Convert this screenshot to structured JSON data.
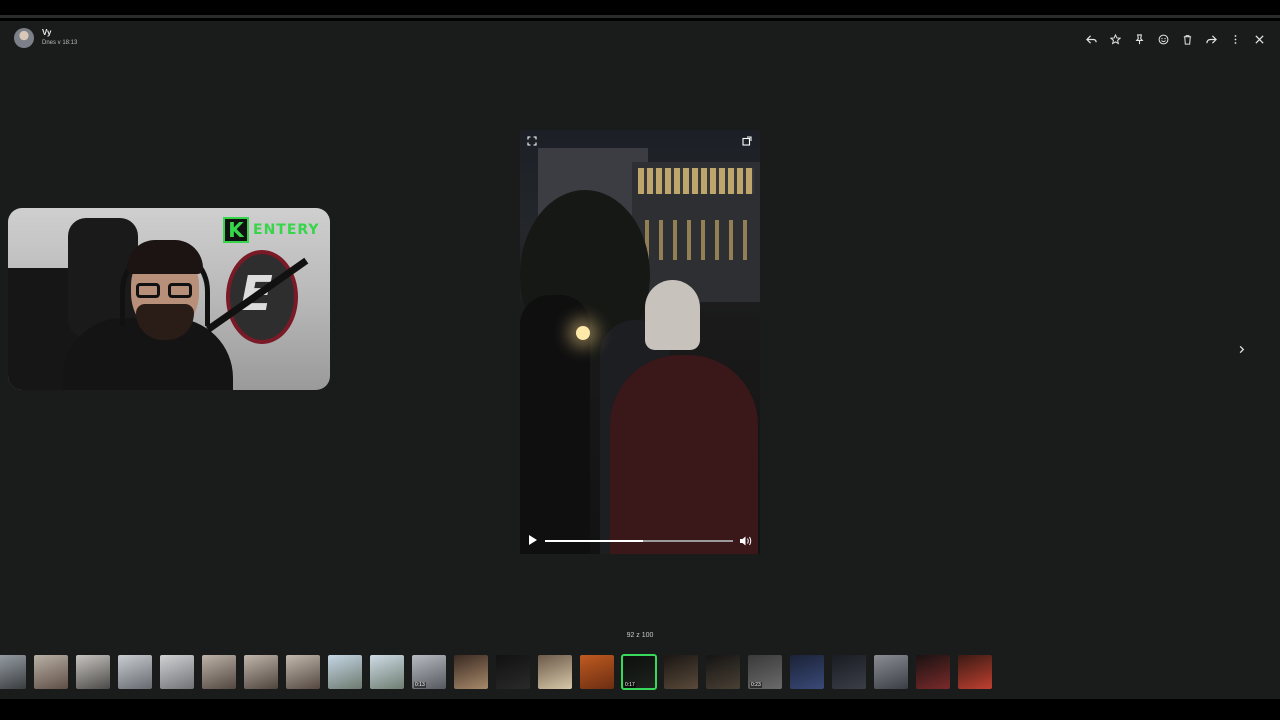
{
  "header": {
    "sender_name": "Vy",
    "timestamp": "Dnes v 18:13"
  },
  "toolbar": {
    "actions": [
      "reply",
      "star",
      "pin",
      "react",
      "delete",
      "forward",
      "more",
      "close"
    ]
  },
  "webcam_overlay": {
    "logo_letter": "K",
    "logo_text": "ENTERY",
    "emblem_letter": "E"
  },
  "video": {
    "progress_fraction": 0.52
  },
  "pager": {
    "counter": "92 z 100"
  },
  "filmstrip": {
    "thumbnails": [
      {
        "duration": "",
        "colors": [
          "#9aa2a8",
          "#3a3d40"
        ]
      },
      {
        "duration": "",
        "colors": [
          "#b9b1a6",
          "#5e4e44"
        ]
      },
      {
        "duration": "",
        "colors": [
          "#c7c4c0",
          "#4c4a48"
        ]
      },
      {
        "duration": "",
        "colors": [
          "#c9ccd0",
          "#666a70"
        ]
      },
      {
        "duration": "",
        "colors": [
          "#d0d2d4",
          "#707276"
        ]
      },
      {
        "duration": "",
        "colors": [
          "#bdb3a8",
          "#524640"
        ]
      },
      {
        "duration": "",
        "colors": [
          "#c0b6ab",
          "#4f443d"
        ]
      },
      {
        "duration": "",
        "colors": [
          "#c3b9ae",
          "#534740"
        ]
      },
      {
        "duration": "",
        "colors": [
          "#c5d6e4",
          "#6d7a70"
        ]
      },
      {
        "duration": "",
        "colors": [
          "#cfdbe6",
          "#6e7e72"
        ]
      },
      {
        "duration": "0:13",
        "colors": [
          "#b7bcc2",
          "#55585d"
        ]
      },
      {
        "duration": "",
        "colors": [
          "#3a2a22",
          "#a88a6a"
        ]
      },
      {
        "duration": "",
        "colors": [
          "#111111",
          "#2a2a2a"
        ]
      },
      {
        "duration": "",
        "colors": [
          "#6a5a4a",
          "#d8c8a8"
        ]
      },
      {
        "duration": "",
        "colors": [
          "#c05a20",
          "#6b2e12"
        ]
      },
      {
        "duration": "0:17",
        "colors": [
          "#0c0e0c",
          "#1e241e"
        ]
      },
      {
        "duration": "",
        "colors": [
          "#1a1614",
          "#5a4a3a"
        ]
      },
      {
        "duration": "",
        "colors": [
          "#141414",
          "#4a4034"
        ]
      },
      {
        "duration": "0:23",
        "colors": [
          "#3a3a3a",
          "#6a6a6a"
        ]
      },
      {
        "duration": "",
        "colors": [
          "#1a2236",
          "#3a4a78"
        ]
      },
      {
        "duration": "",
        "colors": [
          "#1a1c22",
          "#3a3e48"
        ]
      },
      {
        "duration": "",
        "colors": [
          "#8a8e94",
          "#3a3e44"
        ]
      },
      {
        "duration": "",
        "colors": [
          "#1a1212",
          "#7a2a2a"
        ]
      },
      {
        "duration": "",
        "colors": [
          "#3a1a14",
          "#c04030"
        ]
      }
    ],
    "selected_index": 15
  },
  "colors": {
    "accent": "#38d95a",
    "viewer_bg": "#1a1c1c"
  }
}
